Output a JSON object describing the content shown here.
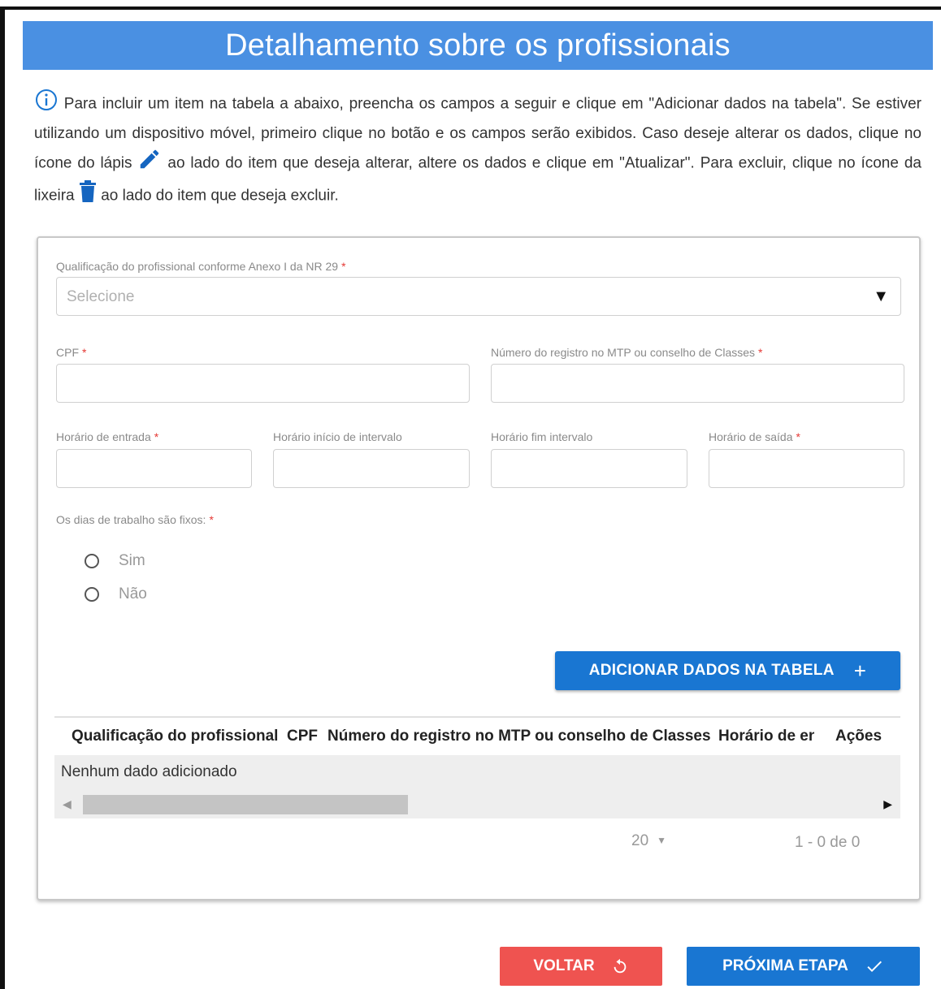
{
  "header": {
    "title": "Detalhamento sobre os profissionais"
  },
  "intro": {
    "part1": "Para incluir um item na tabela a abaixo, preencha os campos a seguir e clique em \"Adicionar dados na tabela\". Se estiver utilizando um dispositivo móvel, primeiro clique no botão e os campos serão exibidos. Caso deseje alterar os dados, clique no ícone do lápis",
    "part2": "ao lado do item que deseja alterar, altere os dados e clique em \"Atualizar\". Para excluir, clique no ícone da lixeira",
    "part3": "ao lado do item que deseja excluir."
  },
  "form": {
    "qualificacao": {
      "label": "Qualificação do profissional conforme Anexo I da NR 29",
      "placeholder": "Selecione",
      "value": ""
    },
    "cpf": {
      "label": "CPF",
      "value": ""
    },
    "registro": {
      "label": "Número do registro no MTP ou conselho de Classes",
      "value": ""
    },
    "entrada": {
      "label": "Horário de entrada",
      "value": ""
    },
    "inicio_intervalo": {
      "label": "Horário início de intervalo",
      "value": ""
    },
    "fim_intervalo": {
      "label": "Horário fim intervalo",
      "value": ""
    },
    "saida": {
      "label": "Horário de saída",
      "value": ""
    },
    "dias_fixos": {
      "label": "Os dias de trabalho são fixos:",
      "options": [
        "Sim",
        "Não"
      ]
    },
    "required_mark": "*"
  },
  "add_button": {
    "label": "ADICIONAR DADOS NA TABELA",
    "icon": "+"
  },
  "table": {
    "columns": [
      "Qualificação do profissional",
      "CPF",
      "Número do registro no MTP ou conselho de Classes",
      "Horário de en",
      "Ações"
    ],
    "empty_text": "Nenhum dado adicionado"
  },
  "pagination": {
    "page_size": "20",
    "info": "1 - 0 de 0"
  },
  "footer": {
    "back_label": "VOLTAR",
    "next_label": "PRÓXIMA ETAPA"
  },
  "colors": {
    "header": "#4a90e2",
    "primary": "#1976d2",
    "danger": "#ef5350",
    "required": "#e53935"
  }
}
